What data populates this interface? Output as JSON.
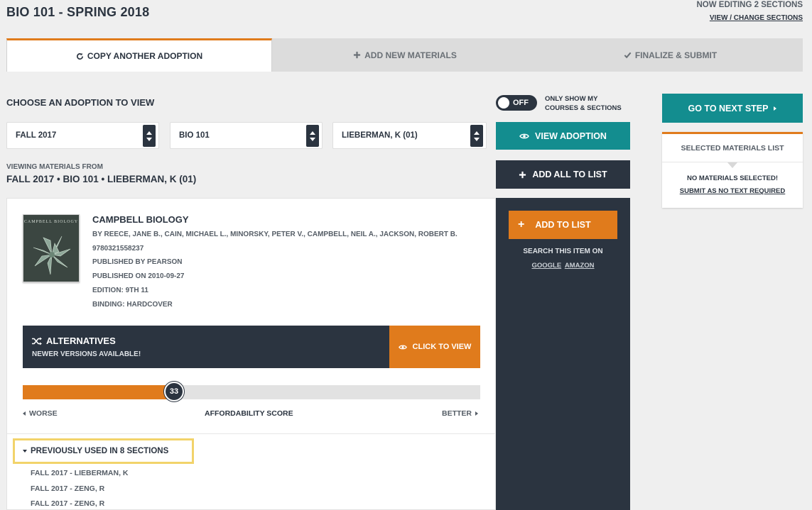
{
  "header": {
    "title": "BIO 101 - SPRING 2018",
    "editing": "NOW EDITING 2 SECTIONS",
    "change_link": "VIEW / CHANGE SECTIONS"
  },
  "tabs": [
    {
      "label": "COPY ANOTHER ADOPTION",
      "icon": "refresh-icon",
      "active": true
    },
    {
      "label": "ADD NEW MATERIALS",
      "icon": "plus-icon",
      "active": false
    },
    {
      "label": "FINALIZE & SUBMIT",
      "icon": "check-icon",
      "active": false
    }
  ],
  "chooser": {
    "heading": "CHOOSE AN ADOPTION TO VIEW",
    "term": "FALL 2017",
    "course": "BIO 101",
    "section": "LIEBERMAN, K (01)",
    "toggle_state": "OFF",
    "toggle_label_1": "ONLY SHOW MY",
    "toggle_label_2": "COURSES & SECTIONS",
    "view_button": "VIEW ADOPTION",
    "add_all_button": "ADD ALL TO LIST"
  },
  "viewing": {
    "label": "VIEWING MATERIALS FROM",
    "value": "FALL 2017 • BIO 101 • LIEBERMAN, K (01)"
  },
  "book": {
    "cover_text": "CAMPBELL BIOLOGY",
    "title": "CAMPBELL BIOLOGY",
    "authors": "BY REECE, JANE B., CAIN, MICHAEL L., MINORSKY, PETER V., CAMPBELL, NEIL A., JACKSON, ROBERT B.",
    "isbn": "9780321558237",
    "publisher": "PUBLISHED BY PEARSON",
    "published": "PUBLISHED ON 2010-09-27",
    "edition": "EDITION: 9TH 11",
    "binding": "BINDING: HARDCOVER"
  },
  "alternatives": {
    "title": "ALTERNATIVES",
    "subtitle": "NEWER VERSIONS AVAILABLE!",
    "button": "CLICK TO VIEW"
  },
  "affordability": {
    "score": 33,
    "score_label": "33",
    "fill_fraction": 0.33,
    "worse": "WORSE",
    "label": "AFFORDABILITY SCORE",
    "better": "BETTER"
  },
  "previously_used": {
    "label": "PREVIOUSLY USED IN 8 SECTIONS",
    "items": [
      "FALL 2017 - LIEBERMAN, K",
      "FALL 2017 - ZENG, R",
      "FALL 2017 - ZENG, R"
    ]
  },
  "side_panel": {
    "add_button": "ADD TO LIST",
    "search_label": "SEARCH THIS ITEM ON",
    "google": "GOOGLE",
    "amazon": "AMAZON"
  },
  "right": {
    "next_step": "GO TO NEXT STEP",
    "selected_title": "SELECTED MATERIALS LIST",
    "no_materials": "NO MATERIALS SELECTED!",
    "submit_none": "SUBMIT AS NO TEXT REQUIRED"
  },
  "colors": {
    "accent_orange": "#e07b1c",
    "teal": "#138d8f",
    "navy": "#2b3440",
    "highlight": "#f2d36a"
  }
}
